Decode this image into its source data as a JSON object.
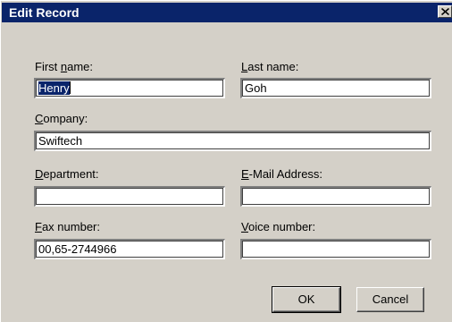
{
  "window": {
    "title": "Edit Record"
  },
  "fields": {
    "first_name": {
      "label_pre": "First ",
      "label_accel": "n",
      "label_post": "ame:",
      "value": "Henry"
    },
    "last_name": {
      "label_pre": "",
      "label_accel": "L",
      "label_post": "ast name:",
      "value": "Goh"
    },
    "company": {
      "label_pre": "",
      "label_accel": "C",
      "label_post": "ompany:",
      "value": "Swiftech"
    },
    "department": {
      "label_pre": "",
      "label_accel": "D",
      "label_post": "epartment:",
      "value": ""
    },
    "email": {
      "label_pre": "",
      "label_accel": "E",
      "label_post": "-Mail Address:",
      "value": ""
    },
    "fax": {
      "label_pre": "",
      "label_accel": "F",
      "label_post": "ax number:",
      "value": "00,65-2744966"
    },
    "voice": {
      "label_pre": "",
      "label_accel": "V",
      "label_post": "oice number:",
      "value": ""
    }
  },
  "buttons": {
    "ok": "OK",
    "cancel": "Cancel"
  },
  "colors": {
    "titlebar": "#0a246a",
    "face": "#d4d0c8",
    "selection": "#0a246a"
  }
}
